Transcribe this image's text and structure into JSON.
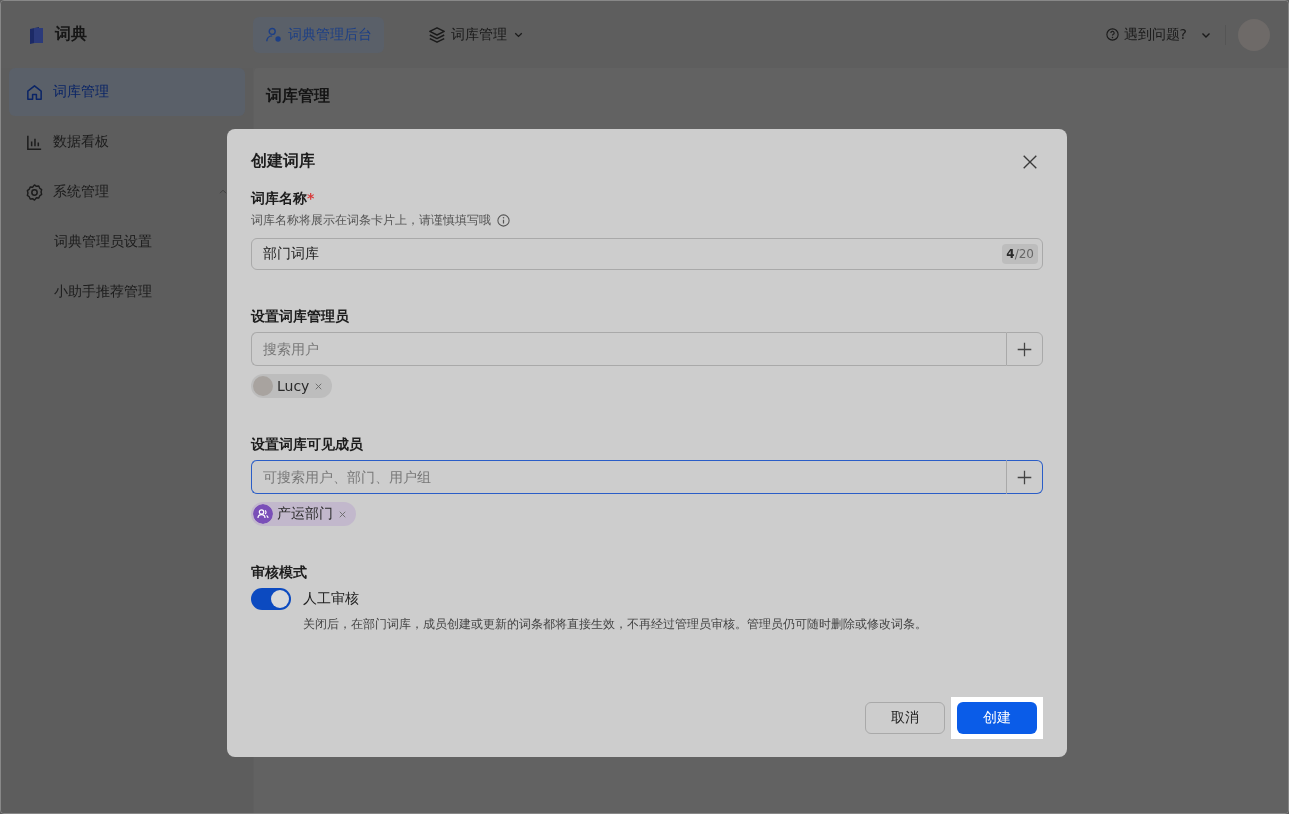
{
  "app": {
    "name": "词典"
  },
  "header": {
    "nav": [
      {
        "label": "词典管理后台",
        "kind": "admin",
        "selected": true
      },
      {
        "label": "词库管理",
        "kind": "layers",
        "selected": false
      }
    ],
    "help": "遇到问题?"
  },
  "sidebar": {
    "items": [
      {
        "label": "词库管理",
        "kind": "home",
        "selected": true
      },
      {
        "label": "数据看板",
        "kind": "chart",
        "selected": false
      },
      {
        "label": "系统管理",
        "kind": "settings",
        "selected": false,
        "expanded": true,
        "children": [
          {
            "label": "词典管理员设置",
            "selected": false
          },
          {
            "label": "小助手推荐管理",
            "selected": false
          }
        ]
      }
    ]
  },
  "page": {
    "title": "词库管理"
  },
  "dialog": {
    "title": "创建词库",
    "fields": [
      {
        "kind": "text",
        "label": "词库名称",
        "required_mark": "*",
        "hint": "词库名称将展示在词条卡片上，请谨慎填写哦",
        "value": "部门词库",
        "counter": "**4**/20"
      },
      {
        "kind": "picker",
        "label": "设置词库管理员",
        "placeholder": "搜索用户",
        "focused": false,
        "tags": [
          {
            "label": "Lucy",
            "kind": "user"
          }
        ]
      },
      {
        "kind": "picker",
        "label": "设置词库可见成员",
        "placeholder": "可搜索用户、部门、用户组",
        "focused": true,
        "tags": [
          {
            "label": "产运部门",
            "kind": "group"
          }
        ]
      },
      {
        "kind": "toggle",
        "label": "审核模式",
        "on": true,
        "toggle_label": "人工审核",
        "description": "关闭后，在部门词库，成员创建或更新的词条都将直接生效，不再经过管理员审核。管理员仍可随时删除或修改词条。"
      }
    ],
    "buttons": [
      {
        "label": "取消",
        "kind": "secondary",
        "highlighted": false
      },
      {
        "label": "创建",
        "kind": "primary",
        "highlighted": true
      }
    ]
  }
}
